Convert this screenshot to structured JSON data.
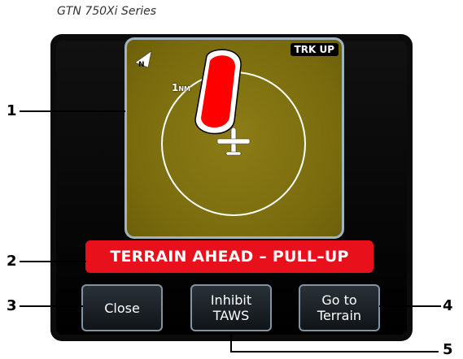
{
  "caption": "GTN 750Xi Series",
  "map": {
    "orientation": "TRK UP",
    "range_value": "1",
    "range_unit": "NM",
    "north_label": "N"
  },
  "alert": {
    "text": "TERRAIN AHEAD – PULL–UP"
  },
  "buttons": {
    "close": "Close",
    "inhibit": "Inhibit\nTAWS",
    "goto": "Go to\nTerrain"
  },
  "callouts": [
    "1",
    "2",
    "3",
    "4",
    "5"
  ],
  "colors": {
    "terrain_red": "#ff0000",
    "alert_bg": "#e8101b",
    "map_bg": "#7a6b0e"
  }
}
